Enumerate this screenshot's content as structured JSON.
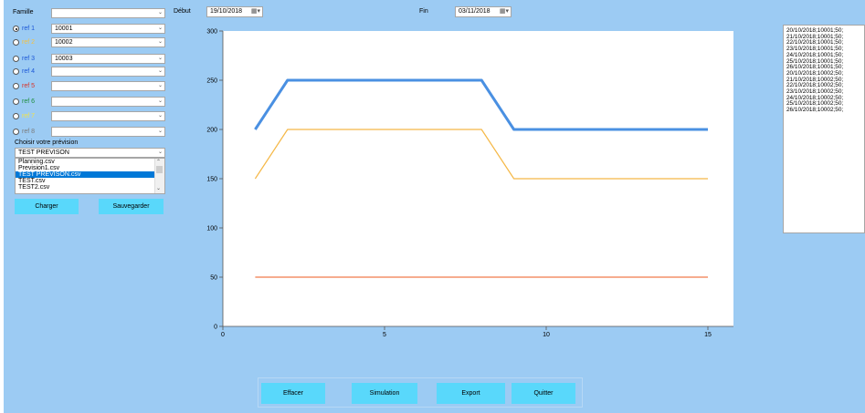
{
  "form": {
    "famille_label": "Famille",
    "famille_value": "",
    "refs": [
      {
        "label": "ref 1",
        "value": "10001",
        "selected": true,
        "color": "#1a56d6"
      },
      {
        "label": "ref 2",
        "value": "10002",
        "selected": false,
        "color": "#f3c142"
      },
      {
        "label": "ref 3",
        "value": "10003",
        "selected": false,
        "color": "#1a56d6"
      },
      {
        "label": "ref 4",
        "value": "",
        "selected": false,
        "color": "#1a56d6"
      },
      {
        "label": "ref 5",
        "value": "",
        "selected": false,
        "color": "#d93025"
      },
      {
        "label": "ref 6",
        "value": "",
        "selected": false,
        "color": "#1e8e3e"
      },
      {
        "label": "ref 7",
        "value": "",
        "selected": false,
        "color": "#f2e24a"
      },
      {
        "label": "ref 8",
        "value": "",
        "selected": false,
        "color": "#7a7a7a"
      }
    ],
    "prevision_label": "Choisir votre prévision",
    "prevision_value": "TEST PREVISON",
    "files": [
      "Planning.csv",
      "Prevision1.csv",
      "TEST PREVISON.csv",
      "TEST.csv",
      "TEST2.csv"
    ],
    "selected_file_index": 2,
    "charger_label": "Charger",
    "sauvegarder_label": "Sauvegarder"
  },
  "dates": {
    "debut_label": "Début",
    "debut_value": "19/10/2018",
    "fin_label": "Fin",
    "fin_value": "03/11/2018"
  },
  "log_lines": [
    "20/10/2018;10001;50;",
    "21/10/2018;10001;50;",
    "22/10/2018;10001;50;",
    "23/10/2018;10001;50;",
    "24/10/2018;10001;50;",
    "25/10/2018;10001;50;",
    "26/10/2018;10001;50;",
    "20/10/2018;10002;50;",
    "21/10/2018;10002;50;",
    "22/10/2018;10002;50;",
    "23/10/2018;10002;50;",
    "24/10/2018;10002;50;",
    "25/10/2018;10002;50;",
    "26/10/2018;10002;50;"
  ],
  "buttons": {
    "effacer": "Effacer",
    "simulation": "Simulation",
    "export": "Export",
    "quitter": "Quitter"
  },
  "chart_data": {
    "type": "line",
    "xlim": [
      0,
      15
    ],
    "ylim": [
      0,
      300
    ],
    "x_ticks": [
      0,
      5,
      10,
      15
    ],
    "y_ticks": [
      0,
      50,
      100,
      150,
      200,
      250,
      300
    ],
    "grid": false,
    "series": [
      {
        "color": "#4a90e2",
        "width": 3,
        "x": [
          1,
          2,
          3,
          4,
          5,
          6,
          7,
          8,
          9,
          10,
          11,
          12,
          13,
          14,
          15
        ],
        "y": [
          200,
          250,
          250,
          250,
          250,
          250,
          250,
          250,
          200,
          200,
          200,
          200,
          200,
          200,
          200
        ]
      },
      {
        "color": "#f5b847",
        "width": 1.2,
        "x": [
          1,
          2,
          3,
          4,
          5,
          6,
          7,
          8,
          9,
          10,
          11,
          12,
          13,
          14,
          15
        ],
        "y": [
          150,
          200,
          200,
          200,
          200,
          200,
          200,
          200,
          150,
          150,
          150,
          150,
          150,
          150,
          150
        ]
      },
      {
        "color": "#f07a4a",
        "width": 1.2,
        "x": [
          1,
          2,
          3,
          4,
          5,
          6,
          7,
          8,
          9,
          10,
          11,
          12,
          13,
          14,
          15
        ],
        "y": [
          50,
          50,
          50,
          50,
          50,
          50,
          50,
          50,
          50,
          50,
          50,
          50,
          50,
          50,
          50
        ]
      }
    ]
  }
}
